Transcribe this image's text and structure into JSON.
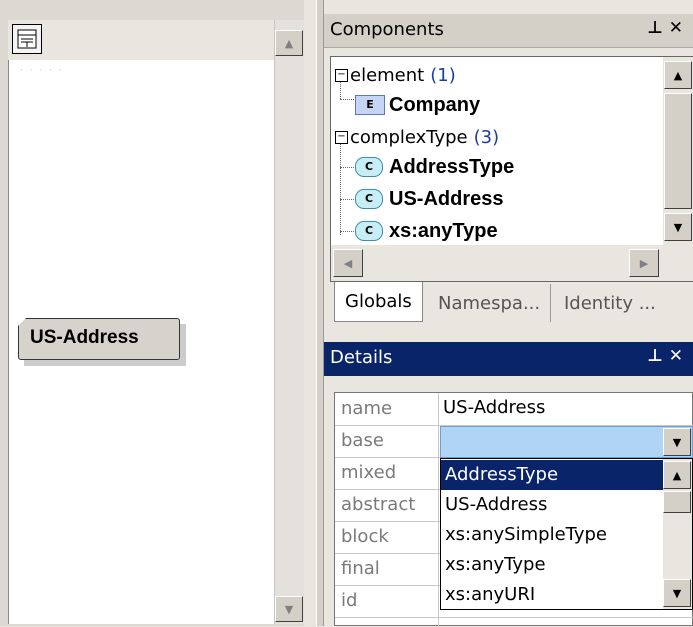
{
  "design": {
    "node_label": "US-Address"
  },
  "components": {
    "title": "Components",
    "tree": [
      {
        "label": "element",
        "count": "(1)"
      },
      {
        "label": "Company",
        "icon": "E"
      },
      {
        "label": "complexType",
        "count": "(3)"
      },
      {
        "label": "AddressType",
        "icon": "C"
      },
      {
        "label": "US-Address",
        "icon": "C"
      },
      {
        "label": "xs:anyType",
        "icon": "C"
      }
    ],
    "tabs": [
      "Globals",
      "Namespa...",
      "Identity ..."
    ]
  },
  "details": {
    "title": "Details",
    "properties": [
      {
        "name": "name",
        "value": "US-Address"
      },
      {
        "name": "base",
        "value": ""
      },
      {
        "name": "mixed",
        "value": ""
      },
      {
        "name": "abstract",
        "value": ""
      },
      {
        "name": "block",
        "value": ""
      },
      {
        "name": "final",
        "value": ""
      },
      {
        "name": "id",
        "value": ""
      }
    ],
    "base_options": [
      "AddressType",
      "US-Address",
      "xs:anySimpleType",
      "xs:anyType",
      "xs:anyURI"
    ],
    "base_selected_option": "AddressType"
  },
  "colors": {
    "details_title_bg": "#0a246a",
    "selection_bg": "#0a246a",
    "base_field_bg": "#b0d4f4"
  }
}
